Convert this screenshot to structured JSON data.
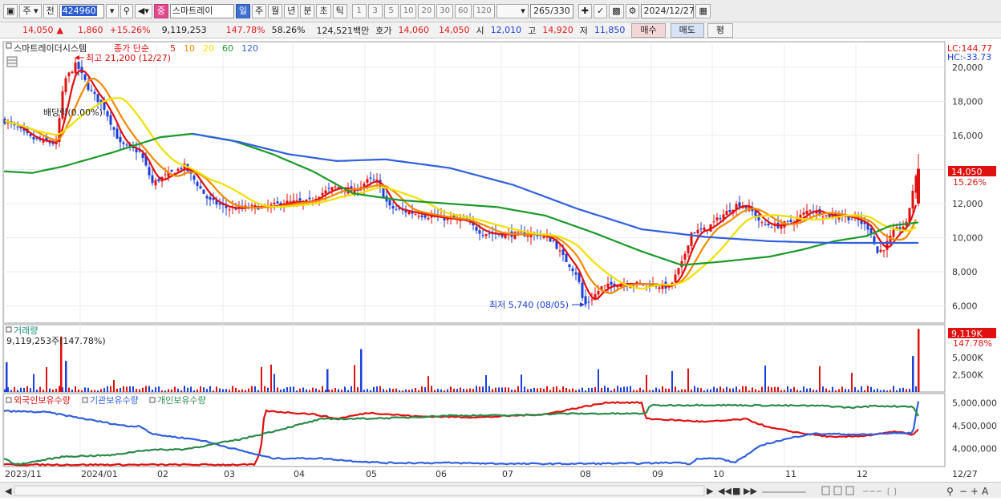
{
  "toolbar": {
    "market_type": "주",
    "prev_label": "전",
    "code": "424960",
    "name_badge": "중",
    "name": "스마트레이",
    "period_tabs": [
      "일",
      "주",
      "월",
      "년",
      "분",
      "초",
      "틱"
    ],
    "active_period": "일",
    "intervals": [
      "1",
      "3",
      "5",
      "10",
      "20",
      "30",
      "60",
      "120"
    ],
    "count_display": "265",
    "count_total": "/330",
    "date": "2024/12/27"
  },
  "info": {
    "price": "14,050",
    "change": "1,860",
    "change_pct": "+15.26%",
    "volume": "9,119,253",
    "vol_ratio": "147.78%",
    "turnover": "58.26%",
    "amount": "124,521백만",
    "quote_label": "호가",
    "quote_ask": "14,060",
    "quote_bid": "14,050",
    "open_label": "시",
    "open": "12,010",
    "high_label": "고",
    "high": "14,920",
    "low_label": "저",
    "low": "11,850",
    "buy_label": "매수",
    "sell_label": "매도",
    "eval_label": "평"
  },
  "price_panel": {
    "title": "스마트레이더시스템",
    "ma_label": "종가 단순",
    "ma_periods": [
      "5",
      "10",
      "20",
      "60",
      "120"
    ],
    "ma_colors": [
      "#e01010",
      "#f08a00",
      "#f2e000",
      "#1a9a2a",
      "#3060e0"
    ],
    "high_annot": "최고 21,200 (12/27)",
    "low_annot": "최저 5,740 (08/05)",
    "dividend_annot": "배당락(0.00%)",
    "lc": "LC:144.77",
    "hc": "HC:-33.73",
    "last_price": "14,050",
    "last_pct": "15.26%",
    "y_ticks": [
      "20,000",
      "18,000",
      "16,000",
      "14,000",
      "12,000",
      "10,000",
      "8,000",
      "6,000"
    ]
  },
  "volume_panel": {
    "title": "거래량",
    "subtitle": "9,119,253주(147.78%)",
    "last": "9,119K",
    "last_pct": "147.78%",
    "y_ticks": [
      "5,000K",
      "2,500K"
    ]
  },
  "holdings_panel": {
    "legend": [
      "외국인보유수량",
      "기관보유수량",
      "개인보유수량"
    ],
    "legend_colors": [
      "#e01010",
      "#3060e0",
      "#2a8a4a"
    ],
    "y_ticks": [
      "5,000,000",
      "4,500,000",
      "4,000,000"
    ]
  },
  "x_axis": {
    "labels": [
      "2023/11",
      "2024/01",
      "02",
      "03",
      "04",
      "05",
      "06",
      "07",
      "08",
      "09",
      "10",
      "11",
      "12"
    ],
    "end_label": "12/27"
  },
  "chart_data": {
    "type": "candlestick",
    "price_ylim": [
      5000,
      21500
    ],
    "close_keyframes": [
      [
        0,
        17000
      ],
      [
        20,
        16500
      ],
      [
        40,
        15800
      ],
      [
        70,
        15500
      ],
      [
        80,
        19200
      ],
      [
        95,
        20200
      ],
      [
        110,
        18800
      ],
      [
        130,
        17600
      ],
      [
        150,
        15500
      ],
      [
        175,
        15000
      ],
      [
        190,
        13200
      ],
      [
        205,
        13600
      ],
      [
        230,
        14200
      ],
      [
        260,
        12200
      ],
      [
        285,
        11700
      ],
      [
        310,
        11800
      ],
      [
        330,
        11800
      ],
      [
        360,
        12100
      ],
      [
        385,
        12100
      ],
      [
        400,
        12600
      ],
      [
        420,
        13000
      ],
      [
        440,
        12700
      ],
      [
        460,
        13400
      ],
      [
        470,
        13300
      ],
      [
        485,
        11800
      ],
      [
        500,
        11600
      ],
      [
        530,
        11300
      ],
      [
        560,
        11100
      ],
      [
        580,
        11000
      ],
      [
        600,
        10300
      ],
      [
        620,
        10200
      ],
      [
        645,
        10200
      ],
      [
        670,
        10200
      ],
      [
        690,
        9800
      ],
      [
        700,
        9000
      ],
      [
        720,
        7800
      ],
      [
        728,
        6000
      ],
      [
        735,
        6300
      ],
      [
        750,
        7100
      ],
      [
        770,
        7300
      ],
      [
        800,
        7300
      ],
      [
        820,
        7200
      ],
      [
        835,
        7100
      ],
      [
        850,
        8500
      ],
      [
        862,
        10300
      ],
      [
        880,
        10500
      ],
      [
        900,
        11300
      ],
      [
        920,
        12000
      ],
      [
        935,
        11700
      ],
      [
        950,
        10800
      ],
      [
        970,
        10700
      ],
      [
        990,
        11000
      ],
      [
        1010,
        11700
      ],
      [
        1030,
        11300
      ],
      [
        1050,
        11300
      ],
      [
        1070,
        11000
      ],
      [
        1085,
        10500
      ],
      [
        1093,
        9100
      ],
      [
        1102,
        9400
      ],
      [
        1115,
        10400
      ],
      [
        1130,
        10800
      ],
      [
        1138,
        12800
      ],
      [
        1145,
        14050
      ]
    ],
    "ma120_keyframes": [
      [
        240,
        16100
      ],
      [
        300,
        15600
      ],
      [
        360,
        14900
      ],
      [
        420,
        14500
      ],
      [
        480,
        14600
      ],
      [
        560,
        14100
      ],
      [
        640,
        13100
      ],
      [
        720,
        11700
      ],
      [
        800,
        10500
      ],
      [
        880,
        10050
      ],
      [
        960,
        9800
      ],
      [
        1040,
        9700
      ],
      [
        1100,
        9700
      ],
      [
        1145,
        9700
      ]
    ],
    "ma60_keyframes": [
      [
        5,
        13900
      ],
      [
        40,
        13800
      ],
      [
        80,
        14200
      ],
      [
        140,
        15000
      ],
      [
        200,
        15900
      ],
      [
        240,
        16100
      ],
      [
        290,
        15700
      ],
      [
        340,
        14900
      ],
      [
        390,
        13900
      ],
      [
        440,
        12600
      ],
      [
        500,
        12200
      ],
      [
        560,
        12000
      ],
      [
        620,
        11800
      ],
      [
        680,
        11300
      ],
      [
        740,
        10300
      ],
      [
        800,
        9200
      ],
      [
        850,
        8400
      ],
      [
        900,
        8600
      ],
      [
        960,
        8900
      ],
      [
        1000,
        9300
      ],
      [
        1040,
        9800
      ],
      [
        1080,
        10100
      ],
      [
        1110,
        10700
      ],
      [
        1145,
        10900
      ]
    ],
    "volume_max_k": 9500,
    "holdings_ylim": [
      3600000,
      5200000
    ],
    "holdings_series": [
      {
        "name": "외국인보유수량",
        "keyframes": [
          [
            0,
            3640000
          ],
          [
            300,
            3640000
          ],
          [
            318,
            3640000
          ],
          [
            325,
            3940000
          ],
          [
            330,
            4820000
          ],
          [
            390,
            4750000
          ],
          [
            420,
            4650000
          ],
          [
            460,
            4780000
          ],
          [
            520,
            4700000
          ],
          [
            600,
            4680000
          ],
          [
            680,
            4750000
          ],
          [
            730,
            4920000
          ],
          [
            760,
            5010000
          ],
          [
            800,
            5000000
          ],
          [
            805,
            4650000
          ],
          [
            850,
            4610000
          ],
          [
            880,
            4580000
          ],
          [
            930,
            4640000
          ],
          [
            960,
            4450000
          ],
          [
            1000,
            4330000
          ],
          [
            1040,
            4240000
          ],
          [
            1080,
            4280000
          ],
          [
            1120,
            4370000
          ],
          [
            1138,
            4280000
          ],
          [
            1145,
            4420000
          ]
        ]
      },
      {
        "name": "기관보유수량",
        "keyframes": [
          [
            0,
            4820000
          ],
          [
            60,
            4790000
          ],
          [
            120,
            4600000
          ],
          [
            160,
            4480000
          ],
          [
            175,
            4490000
          ],
          [
            190,
            4310000
          ],
          [
            250,
            4180000
          ],
          [
            300,
            3950000
          ],
          [
            340,
            3780000
          ],
          [
            400,
            3780000
          ],
          [
            440,
            3720000
          ],
          [
            480,
            3680000
          ],
          [
            560,
            3680000
          ],
          [
            640,
            3660000
          ],
          [
            700,
            3660000
          ],
          [
            800,
            3670000
          ],
          [
            850,
            3690000
          ],
          [
            858,
            3640000
          ],
          [
            870,
            3780000
          ],
          [
            900,
            3770000
          ],
          [
            915,
            3680000
          ],
          [
            935,
            3900000
          ],
          [
            950,
            4070000
          ],
          [
            965,
            4140000
          ],
          [
            985,
            4220000
          ],
          [
            1010,
            4320000
          ],
          [
            1050,
            4310000
          ],
          [
            1080,
            4300000
          ],
          [
            1110,
            4330000
          ],
          [
            1138,
            4330000
          ],
          [
            1145,
            5030000
          ]
        ]
      },
      {
        "name": "개인보유수량",
        "keyframes": [
          [
            0,
            3830000
          ],
          [
            20,
            3640000
          ],
          [
            40,
            3700000
          ],
          [
            80,
            3820000
          ],
          [
            140,
            3850000
          ],
          [
            180,
            3960000
          ],
          [
            230,
            3980000
          ],
          [
            260,
            4070000
          ],
          [
            300,
            4200000
          ],
          [
            340,
            4370000
          ],
          [
            400,
            4640000
          ],
          [
            450,
            4650000
          ],
          [
            500,
            4670000
          ],
          [
            560,
            4720000
          ],
          [
            640,
            4720000
          ],
          [
            700,
            4760000
          ],
          [
            760,
            4760000
          ],
          [
            805,
            4760000
          ],
          [
            810,
            4940000
          ],
          [
            880,
            4950000
          ],
          [
            960,
            4940000
          ],
          [
            1030,
            4930000
          ],
          [
            1060,
            4890000
          ],
          [
            1090,
            4930000
          ],
          [
            1120,
            4920000
          ],
          [
            1138,
            4920000
          ],
          [
            1145,
            4710000
          ]
        ]
      }
    ]
  }
}
